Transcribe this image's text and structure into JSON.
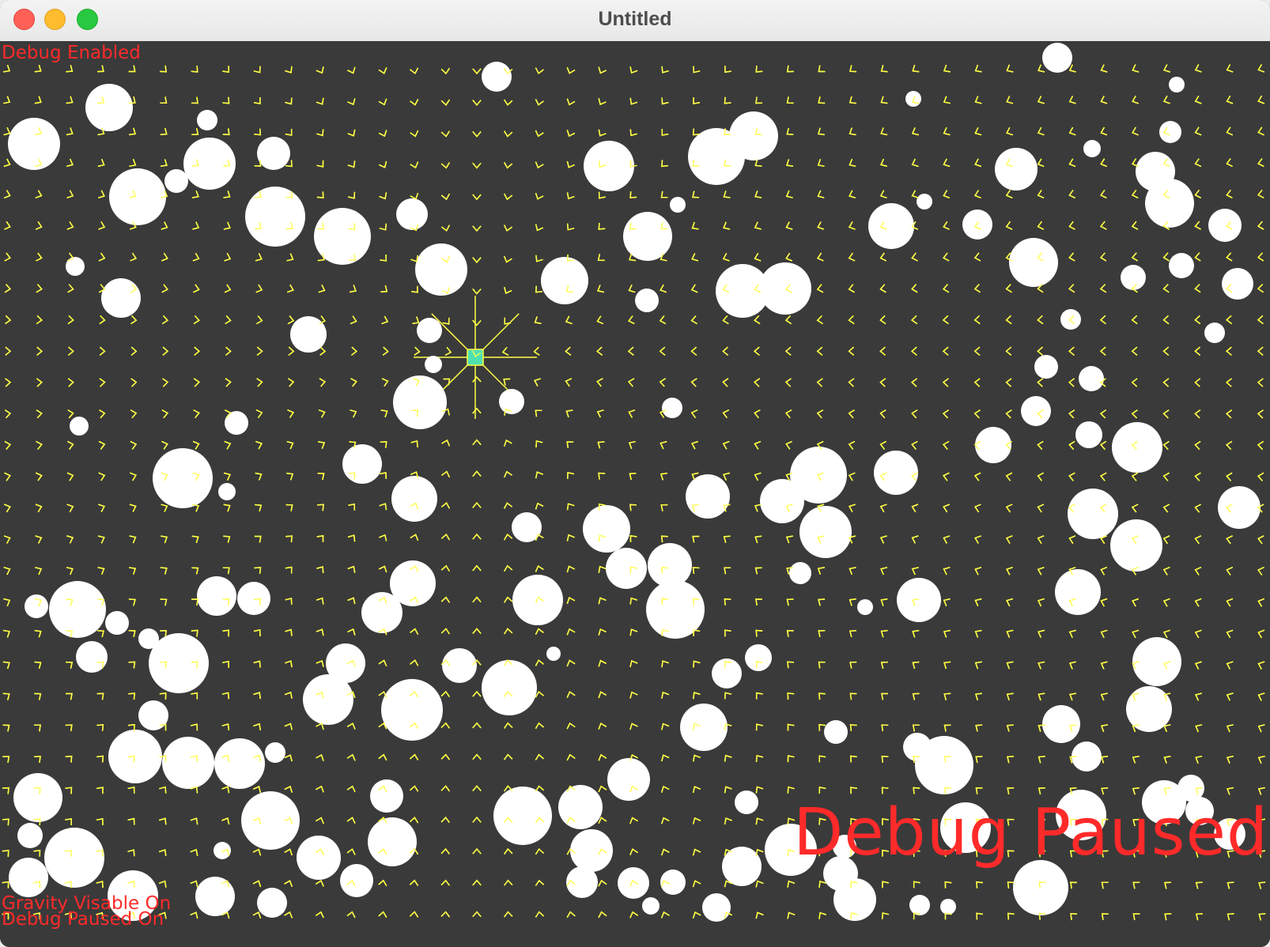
{
  "window": {
    "title": "Untitled",
    "buttons": {
      "close": "close-icon",
      "minimize": "minimize-icon",
      "zoom": "zoom-icon"
    }
  },
  "overlay": {
    "debug_enabled": "Debug Enabled",
    "gravity_visible": "Gravity Visable On",
    "debug_paused_status": "Debug Paused On",
    "debug_paused_banner": "Debug Paused"
  },
  "colors": {
    "background": "#3a3a3a",
    "vector_field": "#ffff44",
    "particles": "#ffffff",
    "debug_text": "#ff2a2a",
    "gravity_source": "#4fe0b0"
  }
}
